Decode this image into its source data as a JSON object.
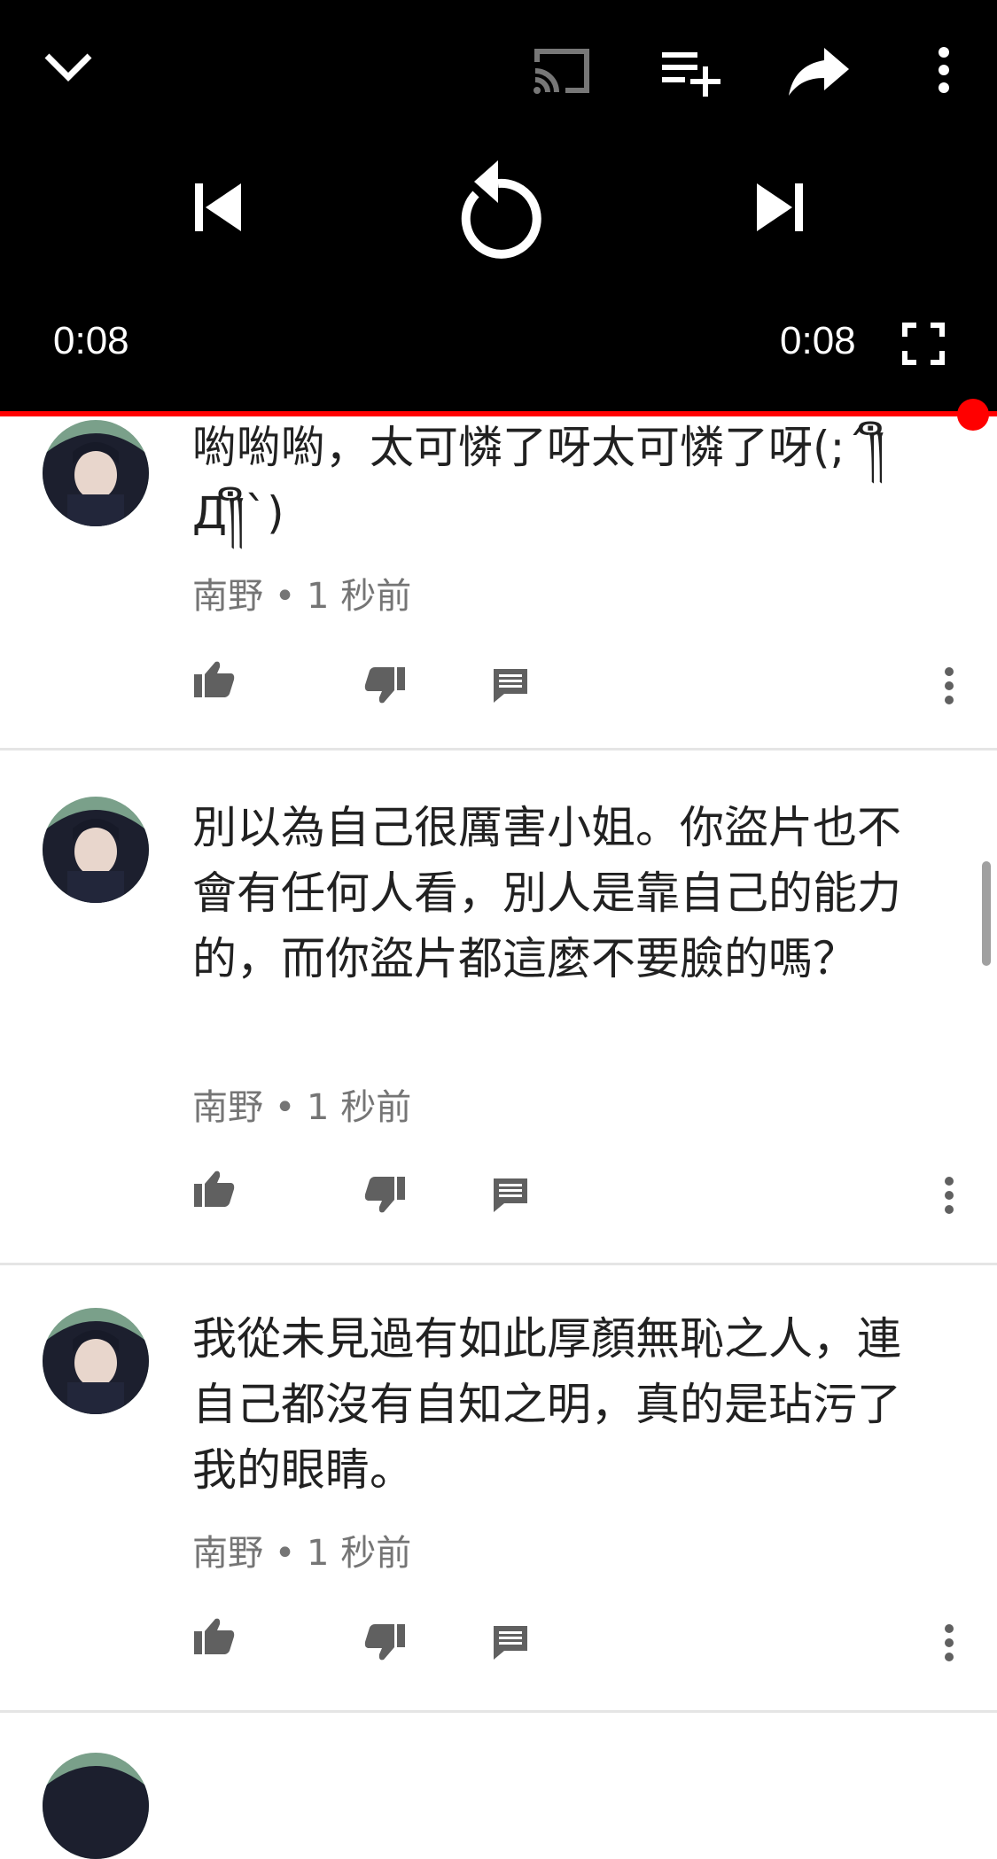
{
  "player": {
    "current_time": "0:08",
    "duration": "0:08",
    "progress_fraction": 1.0,
    "accent_color": "#ff0000",
    "icons": {
      "collapse": "chevron-down-icon",
      "cast": "cast-icon",
      "add_to_queue": "playlist-add-icon",
      "share": "share-icon",
      "more": "more-vert-icon",
      "previous": "skip-previous-icon",
      "replay": "replay-icon",
      "next": "skip-next-icon",
      "fullscreen": "fullscreen-icon"
    }
  },
  "comments": [
    {
      "text": "喲喲喲，太可憐了呀太可憐了呀(;´༎ຶД༎ຶ`)",
      "author": "南野",
      "separator": "•",
      "time": "1 秒前"
    },
    {
      "text": "別以為自己很厲害小姐。你盜片也不會有任何人看，別人是靠自己的能力的，而你盜片都這麼不要臉的嗎？",
      "author": "南野",
      "separator": "•",
      "time": "1 秒前"
    },
    {
      "text": "我從未見過有如此厚顏無恥之人，連自己都沒有自知之明，真的是玷污了我的眼睛。",
      "author": "南野",
      "separator": "•",
      "time": "1 秒前"
    }
  ],
  "comment_actions": {
    "like": "thumb-up-icon",
    "dislike": "thumb-down-icon",
    "reply": "comment-icon",
    "more": "more-vert-icon"
  }
}
